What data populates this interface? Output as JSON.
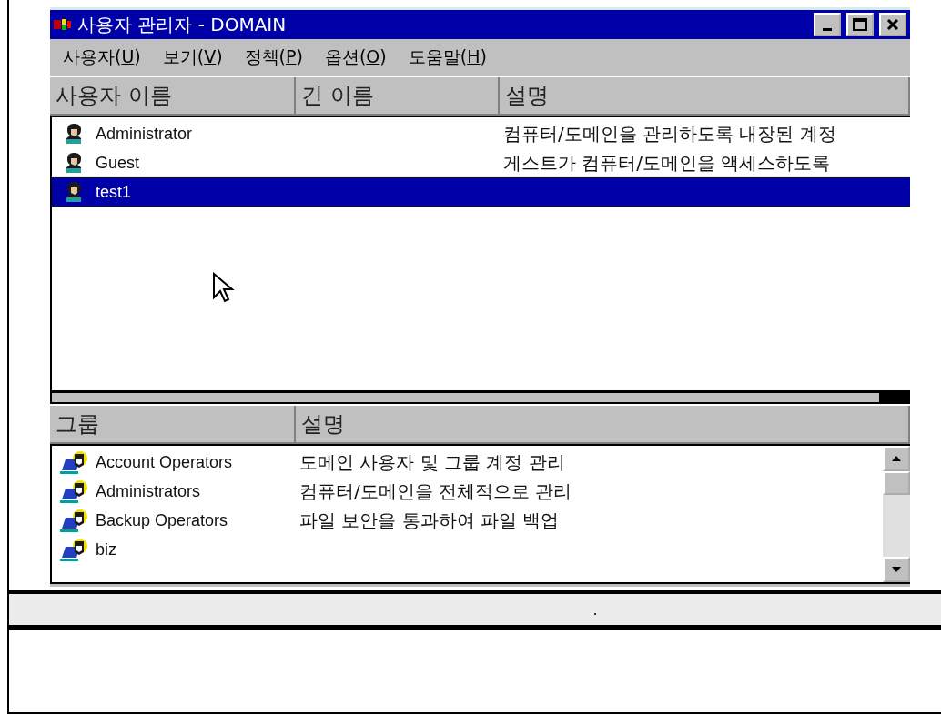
{
  "window": {
    "title": "사용자 관리자 - DOMAIN"
  },
  "menu": [
    {
      "before": "사용자(",
      "key": "U",
      "after": ")"
    },
    {
      "before": "보기(",
      "key": "V",
      "after": ")"
    },
    {
      "before": "정책(",
      "key": "P",
      "after": ")"
    },
    {
      "before": "옵션(",
      "key": "O",
      "after": ")"
    },
    {
      "before": "도움말(",
      "key": "H",
      "after": ")"
    }
  ],
  "users": {
    "columns": [
      "사용자 이름",
      "긴 이름",
      "설명"
    ],
    "rows": [
      {
        "name": "Administrator",
        "description": "컴퓨터/도메인을 관리하도록 내장된 계정",
        "selected": false
      },
      {
        "name": "Guest",
        "description": "게스트가 컴퓨터/도메인을 액세스하도록",
        "selected": false
      },
      {
        "name": "test1",
        "selected": true
      }
    ]
  },
  "groups": {
    "columns": [
      "그룹",
      "설명"
    ],
    "rows": [
      {
        "name": "Account Operators",
        "description": "도메인 사용자 및 그룹 계정 관리"
      },
      {
        "name": "Administrators",
        "description": "컴퓨터/도메인을 전체적으로 관리"
      },
      {
        "name": "Backup Operators",
        "description": "파일 보안을 통과하여 파일 백업"
      },
      {
        "name": "biz"
      }
    ]
  },
  "caption": "."
}
